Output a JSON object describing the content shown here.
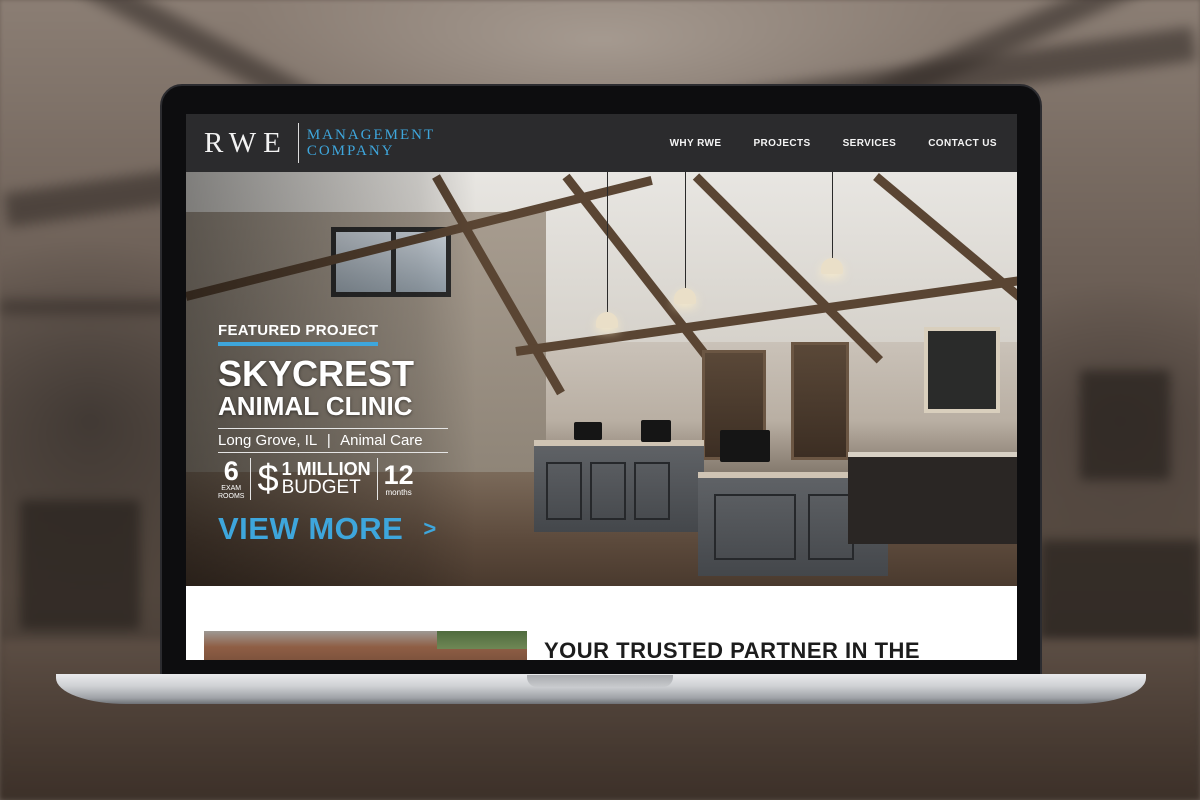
{
  "logo": {
    "mark": "RWE",
    "line1": "MANAGEMENT",
    "line2": "COMPANY"
  },
  "nav": {
    "items": [
      {
        "label": "WHY RWE"
      },
      {
        "label": "PROJECTS"
      },
      {
        "label": "SERVICES"
      },
      {
        "label": "CONTACT US"
      }
    ]
  },
  "hero": {
    "featured_label": "FEATURED PROJECT",
    "project_name": "SKYCREST",
    "project_sub": "ANIMAL CLINIC",
    "location": "Long Grove, IL",
    "category": "Animal Care",
    "separator": "|",
    "stats": {
      "rooms_value": "6",
      "rooms_unit_1": "EXAM",
      "rooms_unit_2": "ROOMS",
      "budget_symbol": "$",
      "budget_amount": "1 MILLION",
      "budget_word": "BUDGET",
      "months_value": "12",
      "months_unit": "months"
    },
    "cta_label": "VIEW MORE",
    "cta_icon": "chevron-right-icon",
    "cta_glyph": ">"
  },
  "lower": {
    "tagline": "YOUR TRUSTED PARTNER IN THE"
  },
  "colors": {
    "accent": "#3ea6dc",
    "header_bg": "#2b2b2d",
    "text_light": "#ffffff"
  }
}
